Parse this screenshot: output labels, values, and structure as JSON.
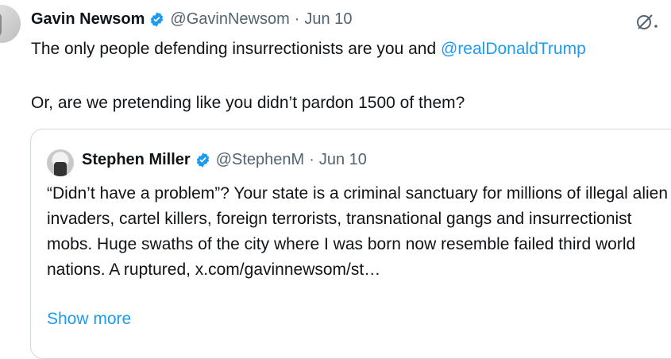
{
  "tweet": {
    "name": "Gavin Newsom",
    "handle": "@GavinNewsom",
    "separator": "·",
    "date": "Jun 10",
    "text_prefix": "The only people defending insurrectionists are you and ",
    "mention": "@realDonaldTrump",
    "text_line2": "Or, are we pretending like you didn’t pardon 1500 of them?",
    "more_icon": "grok-icon"
  },
  "quote": {
    "name": "Stephen Miller",
    "handle": "@StephenM",
    "separator": "·",
    "date": "Jun 10",
    "text": "“Didn’t have a problem”? Your state is a criminal sanctuary for millions of illegal alien invaders, cartel killers, foreign terrorists, transnational gangs and insurrectionist mobs. Huge swaths of the city where I was born now resemble failed third world nations. A ruptured, x.com/gavinnewsom/st…",
    "show_more": "Show more"
  },
  "colors": {
    "link": "#1d9bf0",
    "muted": "#536471",
    "border": "#cfd9de",
    "verified": "#1d9bf0"
  }
}
